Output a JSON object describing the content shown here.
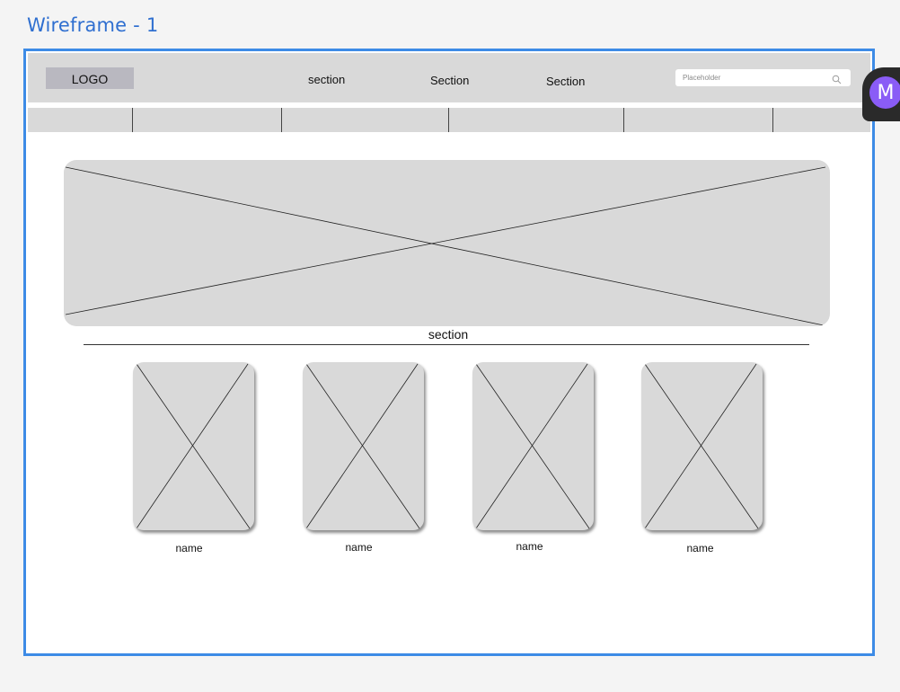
{
  "frame": {
    "title": "Wireframe - 1"
  },
  "header": {
    "logo": "LOGO",
    "nav": [
      "section",
      "Section",
      "Section"
    ],
    "search": {
      "placeholder": "Placeholder",
      "icon": "search-icon"
    }
  },
  "subnav": {
    "segment_count": 6
  },
  "hero": {
    "image": "image-placeholder"
  },
  "content": {
    "section_label": "section"
  },
  "cards": [
    {
      "name": "name"
    },
    {
      "name": "name"
    },
    {
      "name": "name"
    },
    {
      "name": "name"
    }
  ],
  "user": {
    "avatar_initial": "M",
    "avatar_color": "#8a5cf6"
  },
  "colors": {
    "frame_border": "#3d8be6",
    "title": "#2f6fd0",
    "placeholder_fill": "#d9d9d9"
  }
}
